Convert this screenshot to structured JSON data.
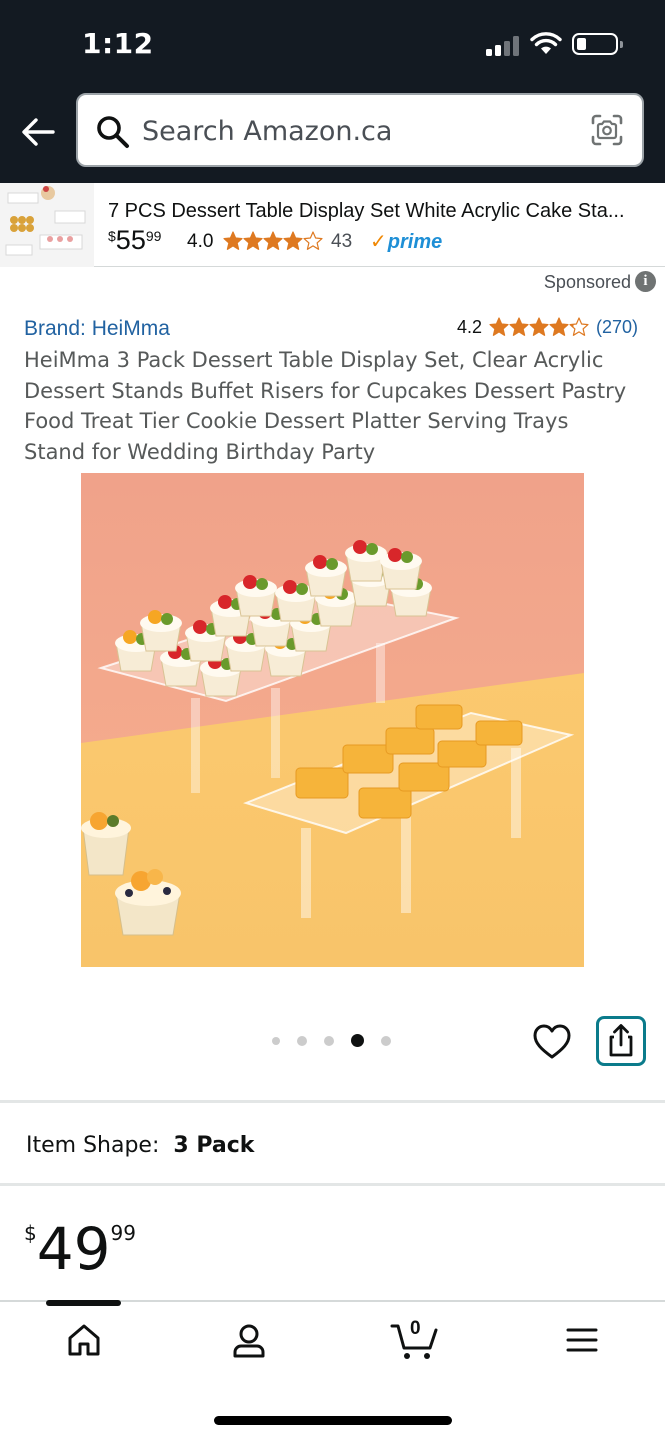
{
  "status_bar": {
    "time": "1:12"
  },
  "search": {
    "placeholder": "Search Amazon.ca"
  },
  "ad": {
    "title": "7 PCS Dessert Table Display Set White Acrylic Cake Sta...",
    "price_whole": "55",
    "price_fraction": "99",
    "currency": "$",
    "rating": "4.0",
    "rating_stars": 4.0,
    "review_count": "43",
    "prime_label": "prime"
  },
  "sponsored_label": "Sponsored",
  "product": {
    "brand": "Brand: HeiMma",
    "rating": "4.2",
    "rating_stars": 4.2,
    "review_count": "(270)",
    "title": "HeiMma 3 Pack Dessert Table Display Set, Clear Acrylic Dessert Stands Buffet Risers for Cupcakes Dessert Pastry Food Treat Tier Cookie Dessert Platter Serving Trays Stand for Wedding Birthday Party",
    "image_count": 5,
    "active_image_index": 3
  },
  "item_shape": {
    "label": "Item Shape:",
    "value": "3 Pack"
  },
  "price": {
    "currency": "$",
    "whole": "49",
    "fraction": "99"
  },
  "bottom_nav": {
    "cart_count": "0",
    "items": [
      "home-icon",
      "account-icon",
      "cart-icon",
      "menu-icon"
    ]
  },
  "colors": {
    "header_bg": "#131a22",
    "link_blue": "#2162a1",
    "star_orange": "#de7921",
    "share_border": "#0b7b8b"
  }
}
